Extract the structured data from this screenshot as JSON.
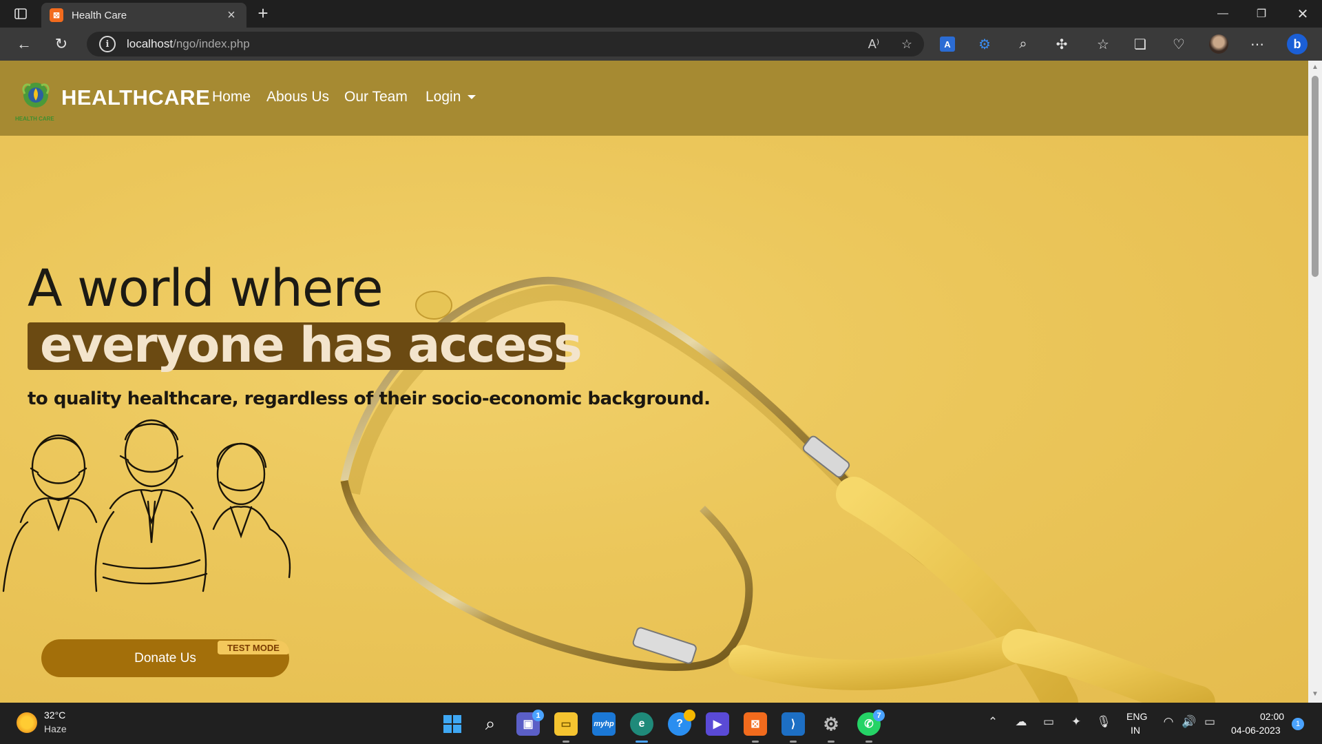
{
  "browser": {
    "tab_title": "Health Care",
    "tab_favicon": "xampp-icon",
    "url_host": "localhost",
    "url_path": "/ngo/index.php",
    "profile_avatar": "avatar"
  },
  "navbar": {
    "brand": "HEALTHCARE",
    "logo_caption": "HEALTH CARE",
    "links": [
      "Home",
      "Abous Us",
      "Our Team",
      "Login"
    ]
  },
  "hero": {
    "line1": "A world where",
    "line2": "everyone has access",
    "line3": "to quality healthcare, regardless of their socio-economic background.",
    "donate_label": "Donate Us",
    "test_mode_label": "TEST MODE"
  },
  "taskbar": {
    "weather_temp": "32°C",
    "weather_condition": "Haze",
    "teams_badge": "1",
    "whatsapp_badge": "7",
    "lang_line1": "ENG",
    "lang_line2": "IN",
    "time": "02:00",
    "date": "04-06-2023",
    "notification_count": "1"
  },
  "colors": {
    "navbar": "#a68a32",
    "hero_bg": "#ebc65a",
    "highlight_box": "#6b4a12",
    "donate_button": "#a36f0a",
    "test_badge": "#f3c85c"
  }
}
